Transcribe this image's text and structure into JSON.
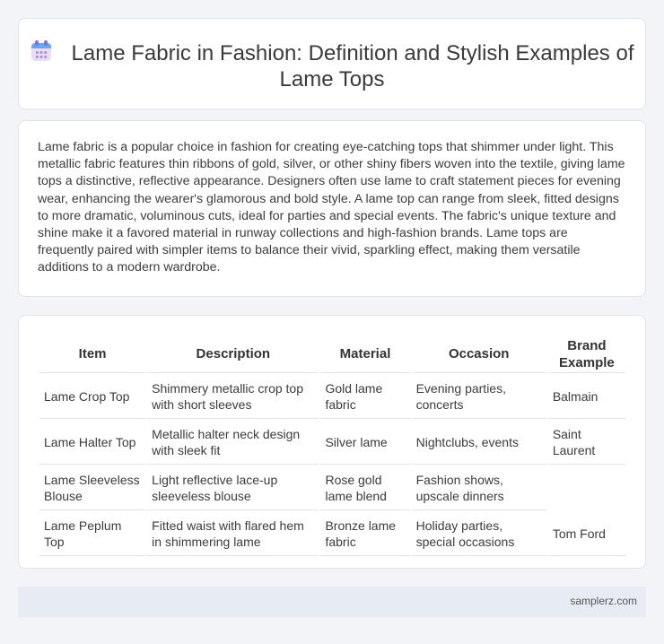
{
  "header": {
    "icon": "calendar-icon",
    "title": "Lame Fabric in Fashion: Definition and Stylish Examples of Lame Tops"
  },
  "description": "Lame fabric is a popular choice in fashion for creating eye-catching tops that shimmer under light. This metallic fabric features thin ribbons of gold, silver, or other shiny fibers woven into the textile, giving lame tops a distinctive, reflective appearance. Designers often use lame to craft statement pieces for evening wear, enhancing the wearer's glamorous and bold style. A lame top can range from sleek, fitted designs to more dramatic, voluminous cuts, ideal for parties and special events. The fabric's unique texture and shine make it a favored material in runway collections and high-fashion brands. Lame tops are frequently paired with simpler items to balance their vivid, sparkling effect, making them versatile additions to a modern wardrobe.",
  "table": {
    "headers": [
      "Item",
      "Description",
      "Material",
      "Occasion",
      "Brand Example"
    ],
    "rows": [
      [
        "Lame Crop Top",
        "Shimmery metallic crop top with short sleeves",
        "Gold lame fabric",
        "Evening parties, concerts",
        "Balmain"
      ],
      [
        "Lame Halter Top",
        "Metallic halter neck design with sleek fit",
        "Silver lame",
        "Nightclubs, events",
        "Saint Laurent"
      ],
      [
        "Lame Sleeveless Blouse",
        "Light reflective lace-up sleeveless blouse",
        "Rose gold lame blend",
        "Fashion shows, upscale dinners",
        ""
      ],
      [
        "Lame Peplum Top",
        "Fitted waist with flared hem in shimmering lame",
        "Bronze lame fabric",
        "Holiday parties, special occasions",
        "Tom Ford"
      ]
    ]
  },
  "footer": {
    "site": "samplerz.com"
  }
}
